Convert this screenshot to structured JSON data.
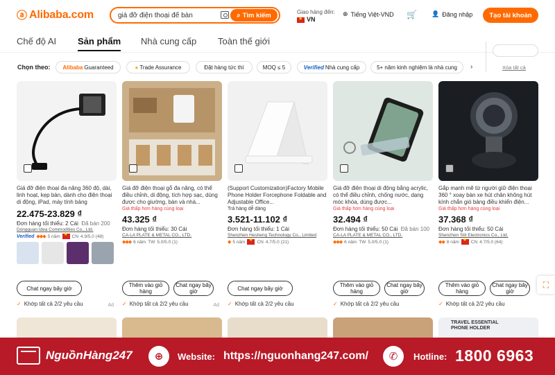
{
  "header": {
    "logo_text": "Alibaba.com",
    "search_value": "giá đỡ điện thoại để bàn",
    "search_button": "Tìm kiếm",
    "deliver_label": "Giao hàng đến:",
    "deliver_country": "VN",
    "language": "Tiếng Việt-VND",
    "login": "Đăng nhập",
    "signup": "Tạo tài khoản"
  },
  "tabs": [
    "Chế độ AI",
    "Sản phẩm",
    "Nhà cung cấp",
    "Toàn thế giới"
  ],
  "filters": {
    "label": "Chọn theo:",
    "chips": [
      "Alibaba",
      "Guaranteed",
      "Trade Assurance",
      "Đặt hàng tức thì",
      "MOQ ≤ 5",
      "Verified",
      "Nhà cung cấp",
      "5+ năm kinh nghiệm là nhà cung"
    ],
    "clear": "Xóa tất cả"
  },
  "products": [
    {
      "title": "Giá đỡ điện thoại đa năng 360 độ, dài, linh hoạt, kẹp bàn, dành cho điện thoại di động, iPad, máy tính bảng",
      "badge": "",
      "price": "22.475-23.829 ₫",
      "moq": "Đơn hàng tối thiểu: 2 Cái",
      "sold": "Đã bán 200",
      "supplier": "Dongguan Idea Commodities Co., Ltd.",
      "verified": "Verified",
      "years": "5 năm",
      "country": "CN",
      "rating": "4.9/5.0 (48)",
      "buttons": [
        "Chat ngay bây giờ"
      ],
      "match": "Khớp tất cả 2/2 yêu cầu",
      "ad": "Ad"
    },
    {
      "title": "Giá đỡ điện thoại gỗ đa năng, có thể điều chỉnh, di động, tích hợp sạc, dùng được cho giường, bàn và nhà...",
      "badge": "Giá thấp hơn hàng cùng loại",
      "price": "43.325 ₫",
      "moq": "Đơn hàng tối thiểu: 30 Cái",
      "sold": "",
      "supplier": "CA-LA PLATE & METAL CO., LTD.",
      "verified": "",
      "years": "6 năm",
      "country": "TW",
      "rating": "5.0/5.0 (1)",
      "buttons": [
        "Thêm vào giỏ hàng",
        "Chat ngay bây giờ"
      ],
      "match": "Khớp tất cả 2/2 yêu cầu",
      "ad": "Ad"
    },
    {
      "title": "(Support Customization)Factory Mobile Phone Holder Forcephone Foldable and Adjustable Office...",
      "badge": "Trả hàng dễ dàng",
      "price": "3.521-11.102 ₫",
      "moq": "Đơn hàng tối thiểu: 1 Cái",
      "sold": "",
      "supplier": "Shenzhen Hesheng Technology Co., Limited",
      "verified": "",
      "years": "5 năm",
      "country": "CN",
      "rating": "4.7/5.0 (21)",
      "buttons": [
        "Chat ngay bây giờ"
      ],
      "match": "Khớp tất cả 2/2 yêu cầu",
      "ad": ""
    },
    {
      "title": "Giá đỡ điện thoại di động bằng acrylic, có thể điều chỉnh, chống nước, dạng móc khóa, dùng được...",
      "badge": "Giá thấp hơn hàng cùng loại",
      "price": "32.494 ₫",
      "moq": "Đơn hàng tối thiểu: 50 Cái",
      "sold": "Đã bán 100",
      "supplier": "CA-LA PLATE & METAL CO., LTD.",
      "verified": "",
      "years": "6 năm",
      "country": "TW",
      "rating": "5.0/5.0 (1)",
      "buttons": [
        "Thêm vào giỏ hàng",
        "Chat ngay bây giờ"
      ],
      "match": "Khớp tất cả 2/2 yêu cầu",
      "ad": ""
    },
    {
      "title": "Gắp mạnh mẽ từ người giữ điện thoại 360 ° xoay bàn xe hút chân không hút kính chắn gió bảng điều khiển điện...",
      "badge": "Giá thấp hơn hàng cùng loại",
      "price": "37.368 ₫",
      "moq": "Đơn hàng tối thiểu: 50 Cái",
      "sold": "",
      "supplier": "Shenzhen Stit Electronics Co., Ltd.",
      "verified": "",
      "years": "8 năm",
      "country": "CN",
      "rating": "4.7/5.0 (64)",
      "buttons": [
        "Thêm vào giỏ hàng",
        "Chat ngay bây giờ"
      ],
      "match": "Khớp tất cả 2/2 yêu cầu",
      "ad": ""
    }
  ],
  "preview_text": "TRAVEL ESSENTIAL PHONE HOLDER",
  "banner": {
    "brand": "NguồnHàng247",
    "website_label": "Website:",
    "url": "https://nguonhang247.com/",
    "hotline_label": "Hotline:",
    "phone": "1800 6963"
  },
  "colors": {
    "accent": "#ff6a00",
    "banner": "#b81a27",
    "verified": "#1a5ec7"
  }
}
